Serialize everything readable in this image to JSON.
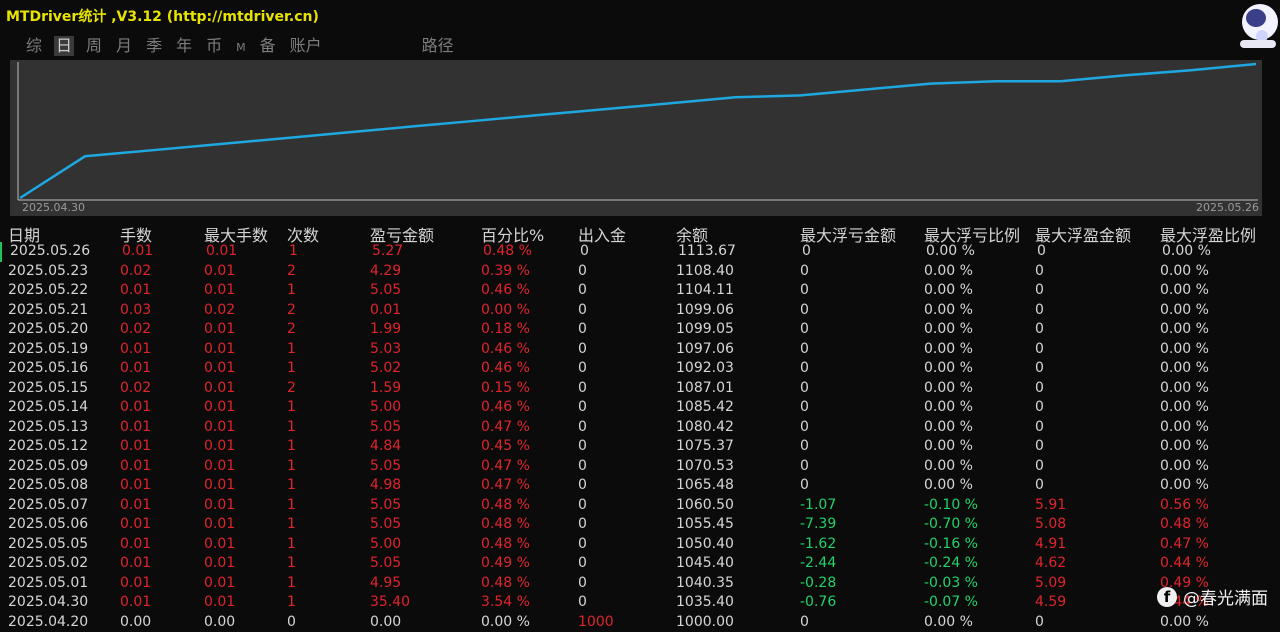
{
  "window": {
    "title": "MTDriver统计 ,V3.12 (http://mtdriver.cn)"
  },
  "tabs": [
    {
      "label": "综",
      "active": false
    },
    {
      "label": "日",
      "active": true
    },
    {
      "label": "周",
      "active": false
    },
    {
      "label": "月",
      "active": false
    },
    {
      "label": "季",
      "active": false
    },
    {
      "label": "年",
      "active": false
    },
    {
      "label": "币",
      "active": false
    },
    {
      "label": "M",
      "active": false
    },
    {
      "label": "备",
      "active": false
    },
    {
      "label": "账户",
      "active": false
    },
    {
      "label": "路径",
      "active": false
    }
  ],
  "chart_data": {
    "type": "line",
    "x_start": "2025.04.30",
    "x_end": "2025.05.26",
    "x": [
      "2025.04.30",
      "2025.05.01",
      "2025.05.02",
      "2025.05.05",
      "2025.05.06",
      "2025.05.07",
      "2025.05.08",
      "2025.05.09",
      "2025.05.12",
      "2025.05.13",
      "2025.05.14",
      "2025.05.15",
      "2025.05.16",
      "2025.05.19",
      "2025.05.20",
      "2025.05.21",
      "2025.05.22",
      "2025.05.23",
      "2025.05.26"
    ],
    "values": [
      1000.0,
      1035.4,
      1040.35,
      1045.4,
      1050.4,
      1055.45,
      1060.5,
      1065.48,
      1070.53,
      1075.37,
      1080.42,
      1085.42,
      1087.01,
      1092.03,
      1097.06,
      1099.05,
      1099.06,
      1104.11,
      1108.4,
      1113.67
    ],
    "color": "#1fa7e0"
  },
  "table": {
    "headers": [
      "日期",
      "手数",
      "最大手数",
      "次数",
      "盈亏金额",
      "百分比%",
      "出入金",
      "余额",
      "最大浮亏金额",
      "最大浮亏比例",
      "最大浮盈金额",
      "最大浮盈比例"
    ],
    "rows": [
      [
        "2025.05.26",
        "0.01",
        "0.01",
        "1",
        "5.27",
        "0.48 %",
        "0",
        "1113.67",
        "0",
        "0.00 %",
        "0",
        "0.00 %"
      ],
      [
        "2025.05.23",
        "0.02",
        "0.01",
        "2",
        "4.29",
        "0.39 %",
        "0",
        "1108.40",
        "0",
        "0.00 %",
        "0",
        "0.00 %"
      ],
      [
        "2025.05.22",
        "0.01",
        "0.01",
        "1",
        "5.05",
        "0.46 %",
        "0",
        "1104.11",
        "0",
        "0.00 %",
        "0",
        "0.00 %"
      ],
      [
        "2025.05.21",
        "0.03",
        "0.02",
        "2",
        "0.01",
        "0.00 %",
        "0",
        "1099.06",
        "0",
        "0.00 %",
        "0",
        "0.00 %"
      ],
      [
        "2025.05.20",
        "0.02",
        "0.01",
        "2",
        "1.99",
        "0.18 %",
        "0",
        "1099.05",
        "0",
        "0.00 %",
        "0",
        "0.00 %"
      ],
      [
        "2025.05.19",
        "0.01",
        "0.01",
        "1",
        "5.03",
        "0.46 %",
        "0",
        "1097.06",
        "0",
        "0.00 %",
        "0",
        "0.00 %"
      ],
      [
        "2025.05.16",
        "0.01",
        "0.01",
        "1",
        "5.02",
        "0.46 %",
        "0",
        "1092.03",
        "0",
        "0.00 %",
        "0",
        "0.00 %"
      ],
      [
        "2025.05.15",
        "0.02",
        "0.01",
        "2",
        "1.59",
        "0.15 %",
        "0",
        "1087.01",
        "0",
        "0.00 %",
        "0",
        "0.00 %"
      ],
      [
        "2025.05.14",
        "0.01",
        "0.01",
        "1",
        "5.00",
        "0.46 %",
        "0",
        "1085.42",
        "0",
        "0.00 %",
        "0",
        "0.00 %"
      ],
      [
        "2025.05.13",
        "0.01",
        "0.01",
        "1",
        "5.05",
        "0.47 %",
        "0",
        "1080.42",
        "0",
        "0.00 %",
        "0",
        "0.00 %"
      ],
      [
        "2025.05.12",
        "0.01",
        "0.01",
        "1",
        "4.84",
        "0.45 %",
        "0",
        "1075.37",
        "0",
        "0.00 %",
        "0",
        "0.00 %"
      ],
      [
        "2025.05.09",
        "0.01",
        "0.01",
        "1",
        "5.05",
        "0.47 %",
        "0",
        "1070.53",
        "0",
        "0.00 %",
        "0",
        "0.00 %"
      ],
      [
        "2025.05.08",
        "0.01",
        "0.01",
        "1",
        "4.98",
        "0.47 %",
        "0",
        "1065.48",
        "0",
        "0.00 %",
        "0",
        "0.00 %"
      ],
      [
        "2025.05.07",
        "0.01",
        "0.01",
        "1",
        "5.05",
        "0.48 %",
        "0",
        "1060.50",
        "-1.07",
        "-0.10 %",
        "5.91",
        "0.56 %"
      ],
      [
        "2025.05.06",
        "0.01",
        "0.01",
        "1",
        "5.05",
        "0.48 %",
        "0",
        "1055.45",
        "-7.39",
        "-0.70 %",
        "5.08",
        "0.48 %"
      ],
      [
        "2025.05.05",
        "0.01",
        "0.01",
        "1",
        "5.00",
        "0.48 %",
        "0",
        "1050.40",
        "-1.62",
        "-0.16 %",
        "4.91",
        "0.47 %"
      ],
      [
        "2025.05.02",
        "0.01",
        "0.01",
        "1",
        "5.05",
        "0.49 %",
        "0",
        "1045.40",
        "-2.44",
        "-0.24 %",
        "4.62",
        "0.44 %"
      ],
      [
        "2025.05.01",
        "0.01",
        "0.01",
        "1",
        "4.95",
        "0.48 %",
        "0",
        "1040.35",
        "-0.28",
        "-0.03 %",
        "5.09",
        "0.49 %"
      ],
      [
        "2025.04.30",
        "0.01",
        "0.01",
        "1",
        "35.40",
        "3.54 %",
        "0",
        "1035.40",
        "-0.76",
        "-0.07 %",
        "4.59",
        "0.44 %"
      ],
      [
        "2025.04.20",
        "0.00",
        "0.00",
        "0",
        "0.00",
        "0.00 %",
        "1000",
        "1000.00",
        "0",
        "0.00 %",
        "0",
        "0.00 %"
      ]
    ]
  },
  "watermark": {
    "text": "@春光满面",
    "icon": "facebook-icon"
  }
}
